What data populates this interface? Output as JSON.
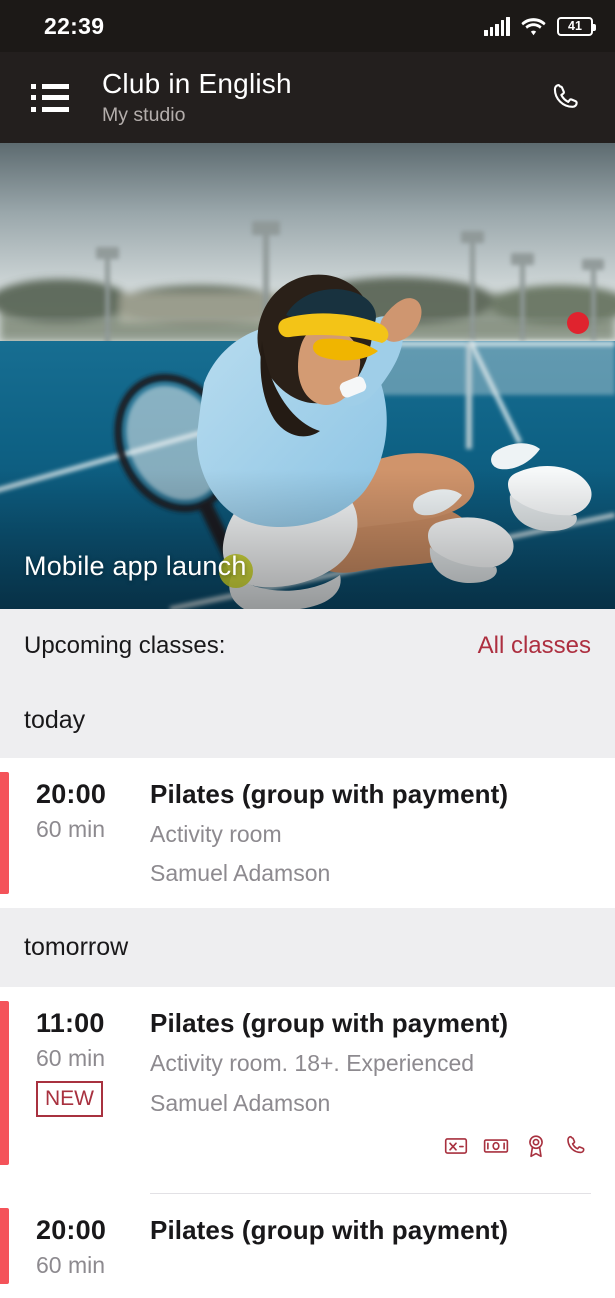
{
  "status_bar": {
    "time": "22:39",
    "battery_level": "41",
    "signal_icon": "signal-bars-icon",
    "wifi_icon": "wifi-icon",
    "battery_icon": "battery-icon"
  },
  "app_bar": {
    "menu_icon": "list-menu-icon",
    "title": "Club in English",
    "subtitle": "My studio",
    "call_icon": "phone-icon"
  },
  "hero": {
    "title": "Mobile app launch",
    "indicator": "record-dot-indicator",
    "indicator_color": "#e0232e",
    "scene": "tennis-court-photo"
  },
  "upcoming": {
    "label": "Upcoming classes:",
    "all_classes_link": "All classes",
    "link_color": "#ad2f40"
  },
  "accent_color": "#f4535a",
  "sections": [
    {
      "day_label": "today",
      "classes": [
        {
          "time": "20:00",
          "duration": "60 min",
          "badge": null,
          "title": "Pilates (group with payment)",
          "room": "Activity room",
          "coach": "Samuel Adamson",
          "icons": []
        }
      ]
    },
    {
      "day_label": "tomorrow",
      "classes": [
        {
          "time": "11:00",
          "duration": "60 min",
          "badge": "NEW",
          "title": "Pilates (group with payment)",
          "room": "Activity room. 18+. Experienced",
          "coach": "Samuel Adamson",
          "icons": [
            "no-card-icon",
            "cash-payment-icon",
            "award-badge-icon",
            "phone-icon"
          ]
        },
        {
          "time": "20:00",
          "duration": "60 min",
          "badge": null,
          "title": "Pilates (group with payment)",
          "room": "",
          "coach": "",
          "icons": []
        }
      ]
    }
  ]
}
